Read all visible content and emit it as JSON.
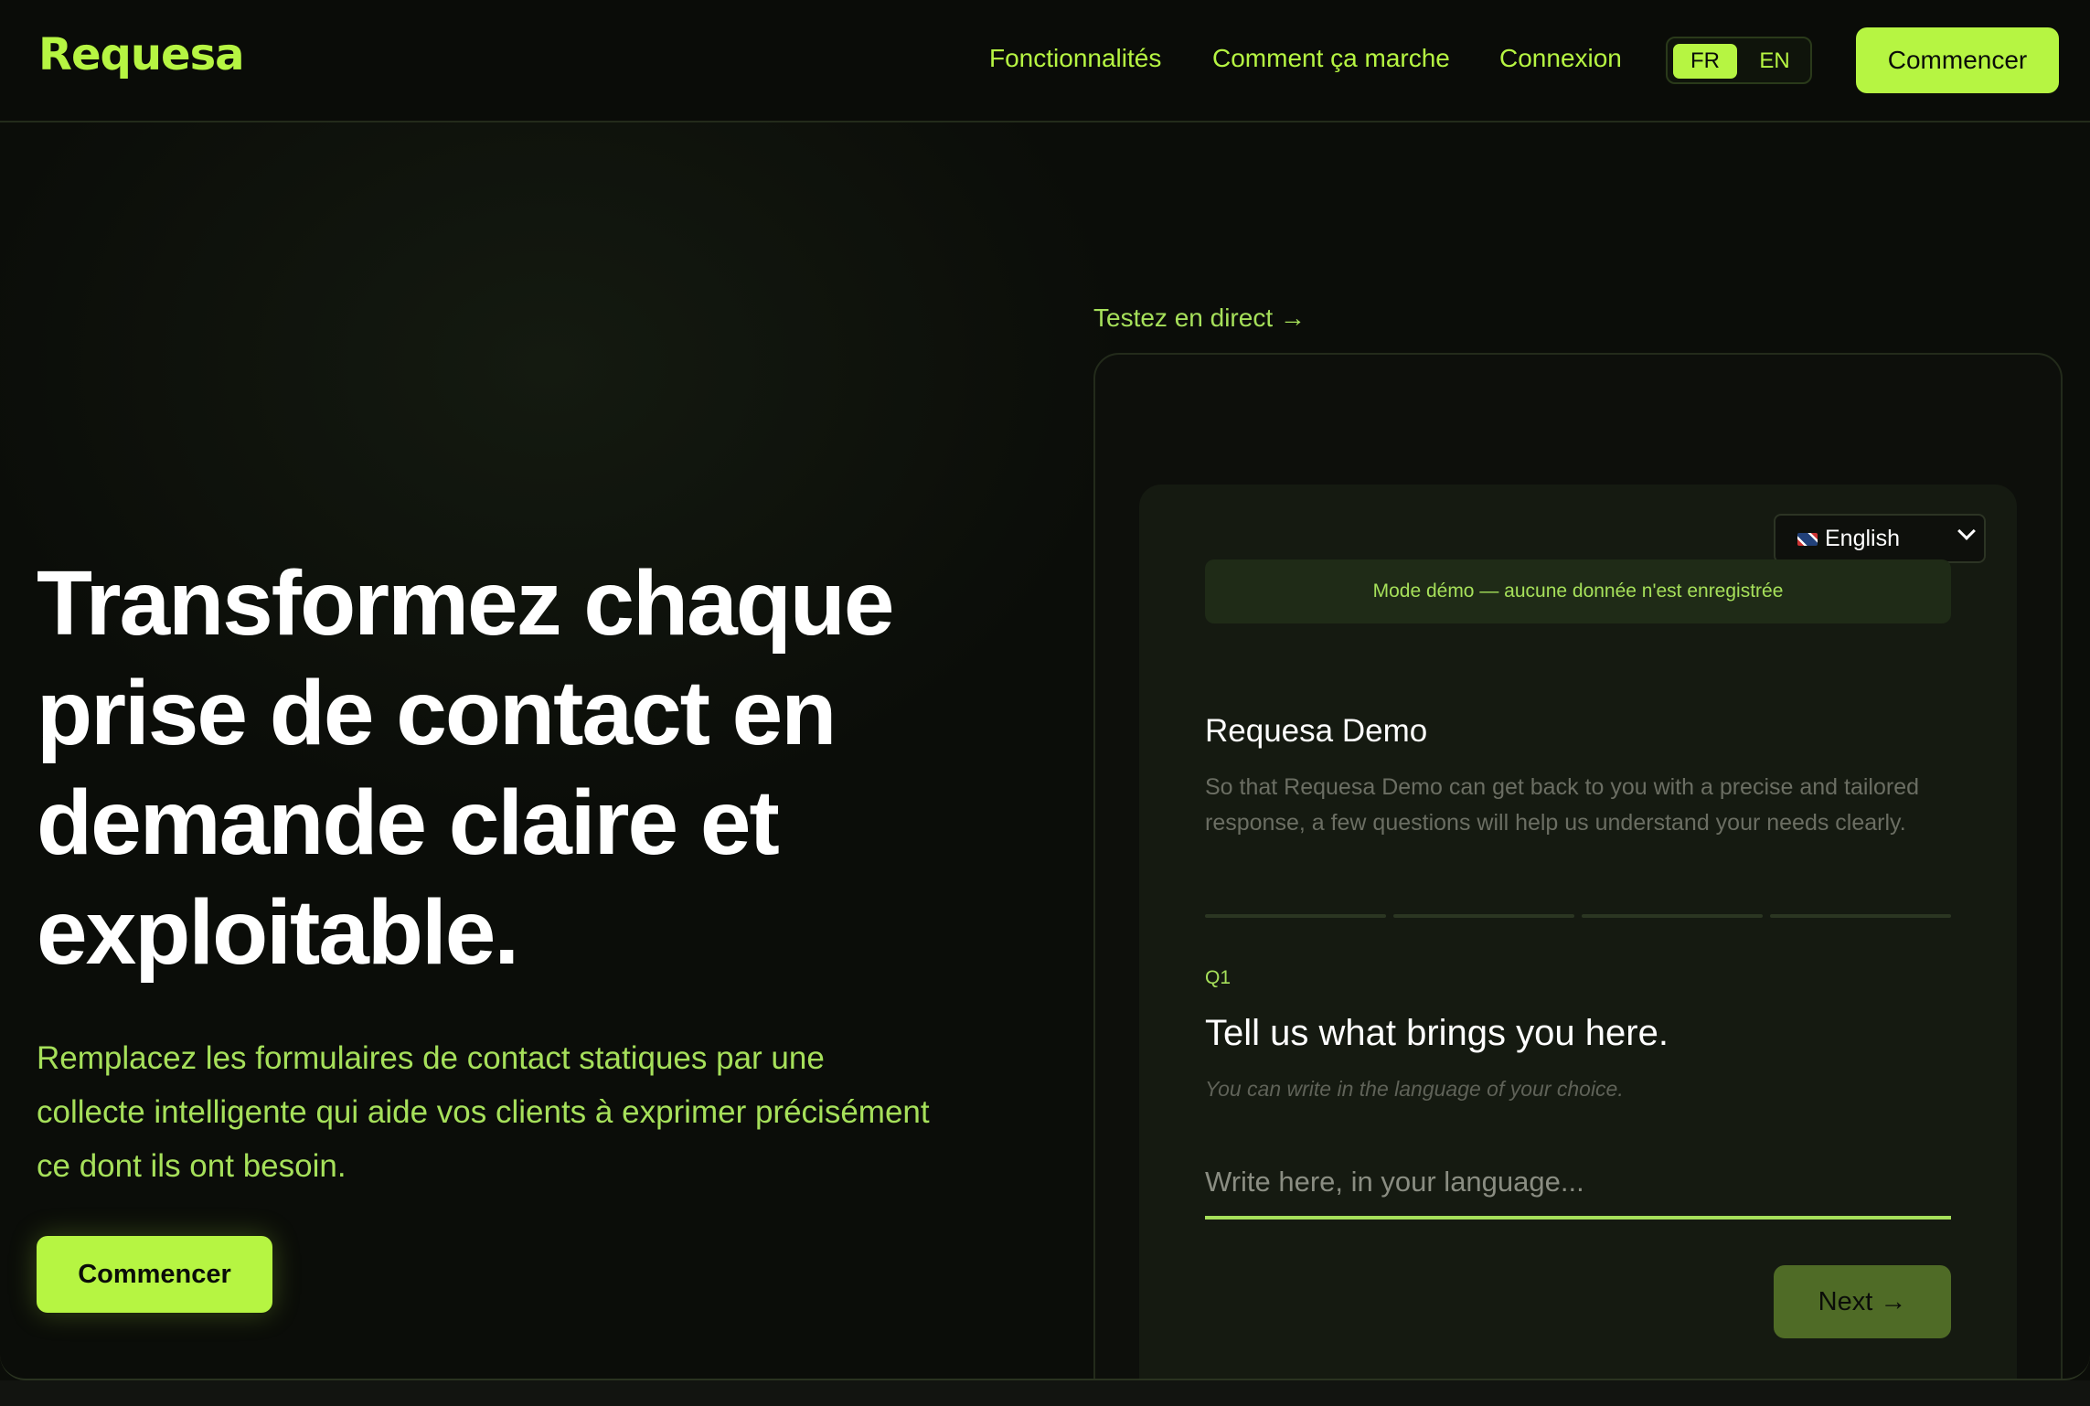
{
  "header": {
    "logo": "Requesa",
    "nav": [
      "Fonctionnalités",
      "Comment ça marche",
      "Connexion"
    ],
    "lang": {
      "fr": "FR",
      "en": "EN"
    },
    "cta": "Commencer"
  },
  "hero": {
    "title": "Transformez chaque prise de contact en demande claire et exploitable.",
    "subtitle": "Remplacez les formulaires de contact statiques par une collecte intelligente qui aide vos clients à exprimer précisément ce dont ils ont besoin.",
    "cta": "Commencer"
  },
  "demo": {
    "label": "Testez en direct →",
    "language": "English",
    "banner": "Mode démo — aucune donnée n'est enregistrée",
    "form_title": "Requesa Demo",
    "form_desc": "So that Requesa Demo can get back to you with a precise and tailored response, a few questions will help us understand your needs clearly.",
    "progress_total": 4,
    "question_number": "Q1",
    "question": "Tell us what brings you here.",
    "hint": "You can write in the language of your choice.",
    "answer_placeholder": "Write here, in your language...",
    "next": "Next →"
  },
  "colors": {
    "accent": "#b6f542",
    "background": "#0b0d09"
  }
}
